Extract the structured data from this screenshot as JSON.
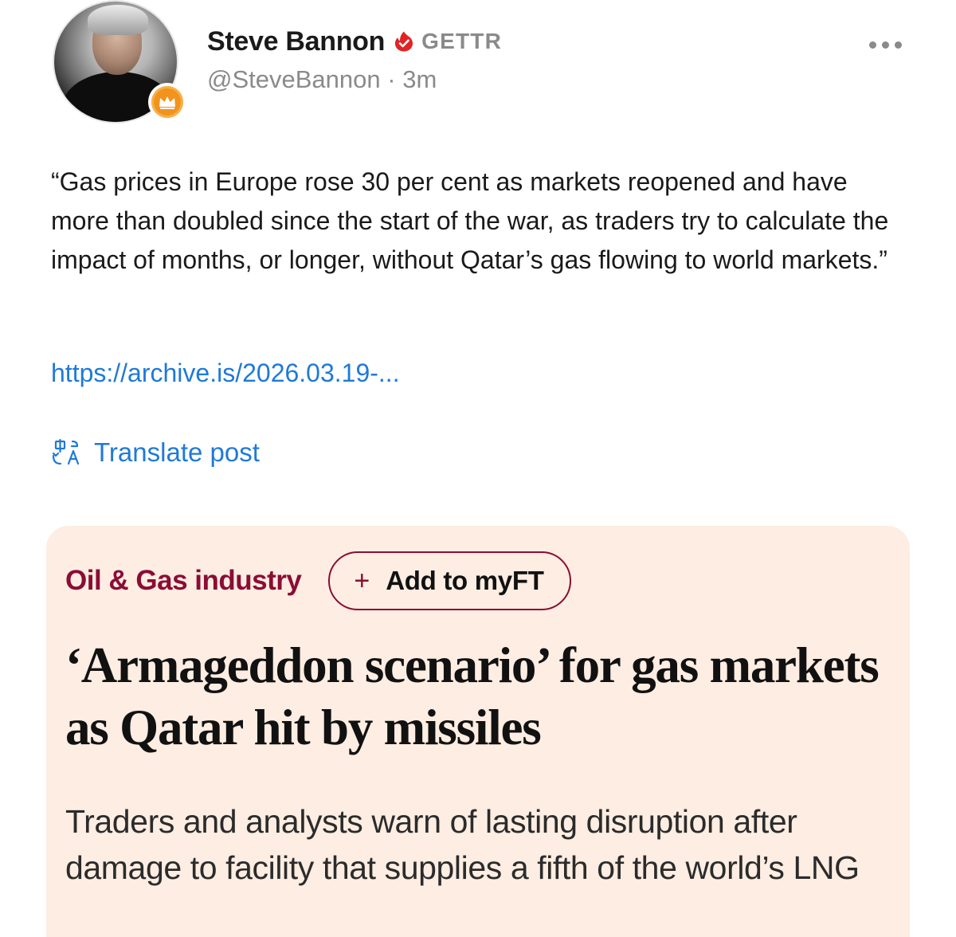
{
  "author": {
    "name": "Steve Bannon",
    "platform": "GETTR",
    "handle": "@SteveBannon",
    "separator": "·",
    "time_ago": "3m",
    "verified_icon": "verified-badge-icon",
    "badge_icon": "crown-icon"
  },
  "post": {
    "text": "“Gas prices in Europe rose 30 per cent as markets reopened and have more than doubled since the start of the war, as traders try to calculate the impact of months, or longer, without Qatar’s gas flowing to world markets.”",
    "link": "https://archive.is/2026.03.19-...",
    "translate_label": "Translate post"
  },
  "article_card": {
    "topic": "Oil & Gas industry",
    "myft_plus": "+",
    "myft_label": "Add to myFT",
    "headline": "‘Armageddon scenario’ for gas markets as Qatar hit by missiles",
    "standfirst": "Traders and analysts warn of lasting disruption after damage to facility that supplies a fifth of the world’s LNG"
  },
  "colors": {
    "accent_red": "#e02424",
    "link_blue": "#1f7ad6",
    "ft_claret": "#8a0d35",
    "ft_background": "#fdede2",
    "badge_orange": "#f2931d",
    "muted_gray": "#8a8a8a"
  }
}
